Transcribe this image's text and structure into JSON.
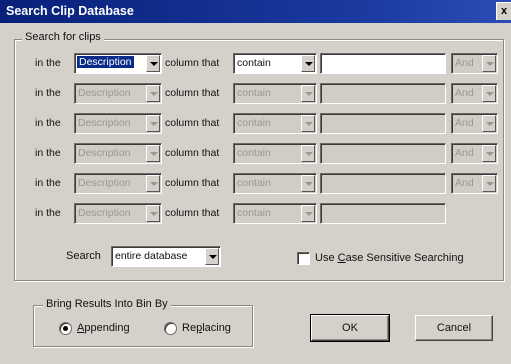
{
  "window": {
    "title": "Search Clip Database",
    "close_glyph": "x"
  },
  "search_group": {
    "legend": "Search for clips"
  },
  "rows": [
    {
      "in_the": "in the",
      "column_value": "Description",
      "column_that": "column that",
      "op_value": "contain",
      "term": "",
      "conj": "And",
      "enabled": true,
      "has_conj": true
    },
    {
      "in_the": "in the",
      "column_value": "Description",
      "column_that": "column that",
      "op_value": "contain",
      "term": "",
      "conj": "And",
      "enabled": false,
      "has_conj": true
    },
    {
      "in_the": "in the",
      "column_value": "Description",
      "column_that": "column that",
      "op_value": "contain",
      "term": "",
      "conj": "And",
      "enabled": false,
      "has_conj": true
    },
    {
      "in_the": "in the",
      "column_value": "Description",
      "column_that": "column that",
      "op_value": "contain",
      "term": "",
      "conj": "And",
      "enabled": false,
      "has_conj": true
    },
    {
      "in_the": "in the",
      "column_value": "Description",
      "column_that": "column that",
      "op_value": "contain",
      "term": "",
      "conj": "And",
      "enabled": false,
      "has_conj": true
    },
    {
      "in_the": "in the",
      "column_value": "Description",
      "column_that": "column that",
      "op_value": "contain",
      "term": "",
      "conj": "",
      "enabled": false,
      "has_conj": false
    }
  ],
  "scope": {
    "label": "Search",
    "value": "entire database"
  },
  "case_sensitive": {
    "pre": "Use ",
    "accel": "C",
    "post": "ase Sensitive Searching",
    "checked": false
  },
  "bin_group": {
    "legend": "Bring Results Into Bin By",
    "appending": {
      "accel": "A",
      "rest": "ppending",
      "selected": true
    },
    "replacing": {
      "pre": "Re",
      "accel": "p",
      "rest": "lacing",
      "selected": false
    }
  },
  "buttons": {
    "ok": "OK",
    "cancel": "Cancel"
  },
  "colors": {
    "title_bar": "#08207a",
    "face": "#d3d1c9",
    "selection": "#0a2a8a"
  }
}
